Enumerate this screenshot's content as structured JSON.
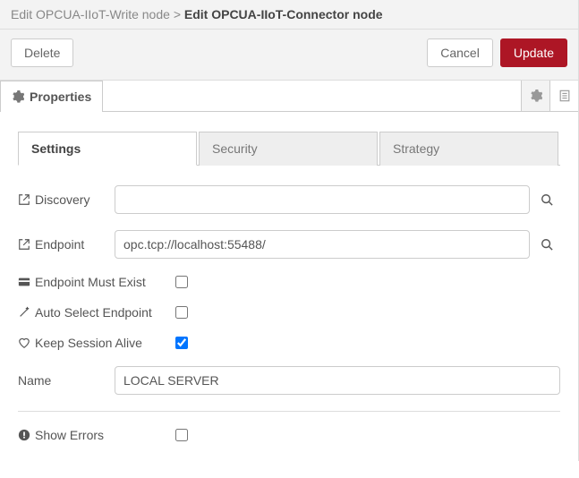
{
  "breadcrumb": {
    "prev": "Edit OPCUA-IIoT-Write node",
    "sep": ">",
    "current": "Edit OPCUA-IIoT-Connector node"
  },
  "toolbar": {
    "delete": "Delete",
    "cancel": "Cancel",
    "update": "Update"
  },
  "section": {
    "properties": "Properties"
  },
  "tabs": {
    "settings": "Settings",
    "security": "Security",
    "strategy": "Strategy"
  },
  "fields": {
    "discovery_label": "Discovery",
    "discovery_value": "",
    "endpoint_label": "Endpoint",
    "endpoint_value": "opc.tcp://localhost:55488/",
    "endpoint_must_exist_label": "Endpoint Must Exist",
    "auto_select_label": "Auto Select Endpoint",
    "keep_session_label": "Keep Session Alive",
    "name_label": "Name",
    "name_value": "LOCAL SERVER",
    "show_errors_label": "Show Errors"
  }
}
